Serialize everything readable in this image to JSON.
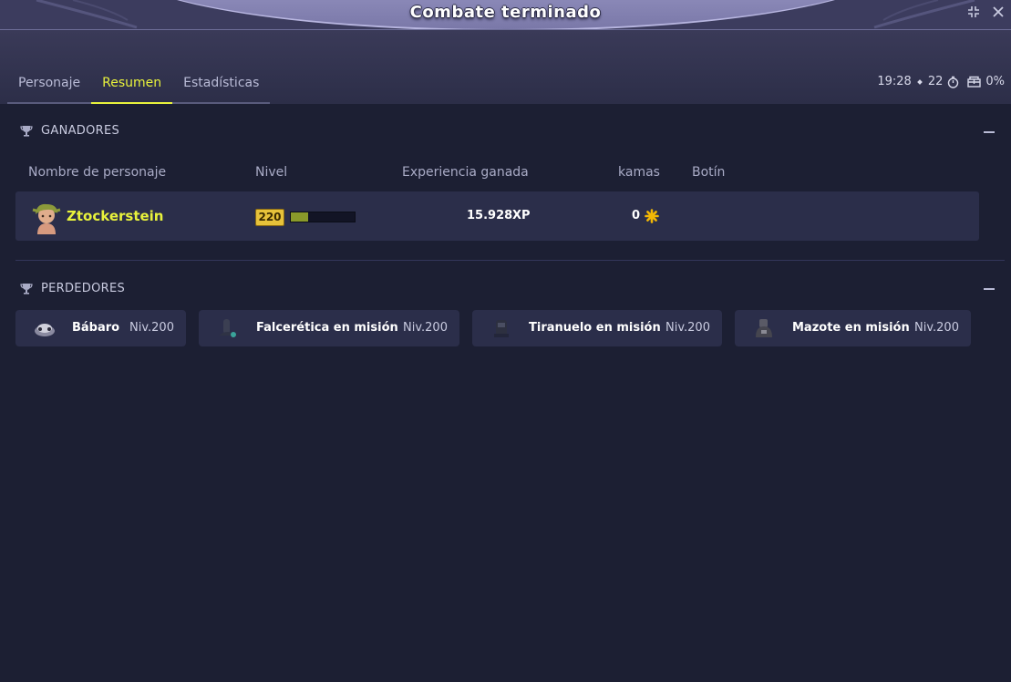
{
  "window": {
    "title": "Combate terminado"
  },
  "tabs": [
    {
      "label": "Personaje",
      "active": false
    },
    {
      "label": "Resumen",
      "active": true
    },
    {
      "label": "Estadísticas",
      "active": false
    }
  ],
  "status": {
    "time": "19:28",
    "turns": "22",
    "percent": "0%",
    "icons": [
      "timer-icon",
      "chest-icon"
    ]
  },
  "winners": {
    "title": "GANADORES",
    "columns": {
      "name": "Nombre de personaje",
      "level": "Nivel",
      "xp": "Experiencia ganada",
      "kamas": "kamas",
      "loot": "Botín"
    },
    "rows": [
      {
        "name": "Ztockerstein",
        "level": "220",
        "xp_progress": 0.27,
        "xp": "15.928",
        "xp_unit": "XP",
        "kamas": "0"
      }
    ]
  },
  "losers": {
    "title": "PERDEDORES",
    "items": [
      {
        "name": "Bábaro",
        "level": "Niv.200"
      },
      {
        "name": "Falcerética en misión",
        "level": "Niv.200"
      },
      {
        "name": "Tiranuelo en misión",
        "level": "Niv.200"
      },
      {
        "name": "Mazote en misión",
        "level": "Niv.200"
      }
    ]
  },
  "colors": {
    "accent": "#e8f23c",
    "background": "#1c1f33",
    "row": "#2b2e4a",
    "level_badge": "#e7c23a",
    "kamas_icon": "#f2b705"
  }
}
